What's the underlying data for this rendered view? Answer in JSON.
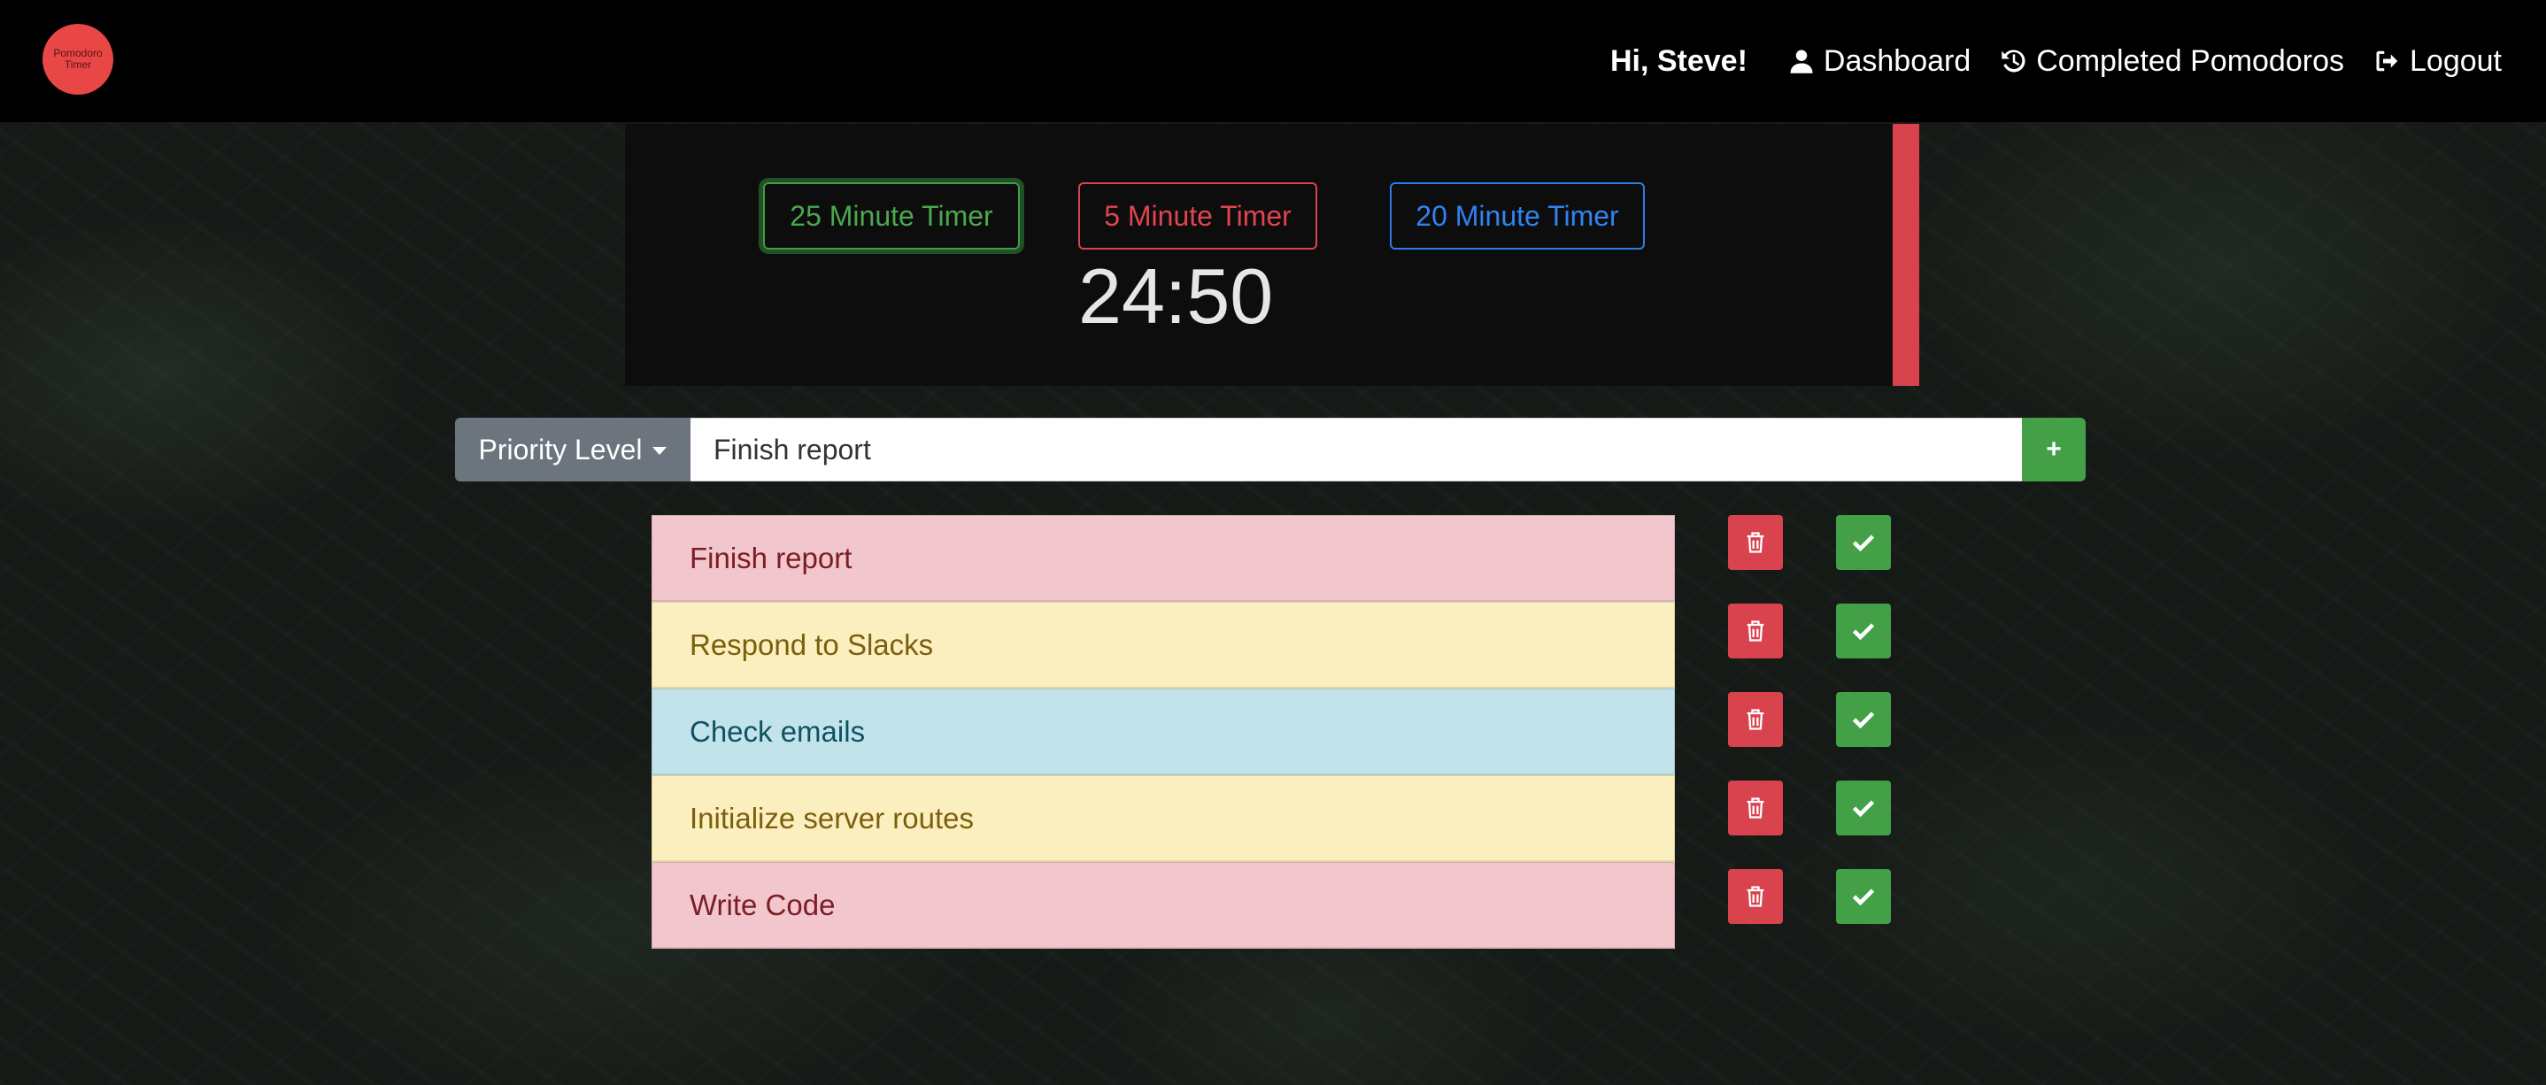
{
  "navbar": {
    "logo_line1": "Pomodoro",
    "logo_line2": "Timer",
    "greeting": "Hi, Steve!",
    "links": [
      {
        "label": "Dashboard",
        "icon": "user-icon"
      },
      {
        "label": "Completed Pomodoros",
        "icon": "history-icon"
      },
      {
        "label": "Logout",
        "icon": "sign-out-icon"
      }
    ]
  },
  "timer": {
    "buttons": [
      {
        "label": "25 Minute Timer",
        "color": "#3c9f43"
      },
      {
        "label": "5 Minute Timer",
        "color": "#d9434e"
      },
      {
        "label": "20 Minute Timer",
        "color": "#2f7ce8"
      }
    ],
    "time": "24:50"
  },
  "task_input": {
    "priority_label": "Priority Level",
    "value": "Finish report",
    "add_label": "+"
  },
  "tasks": [
    {
      "text": "Finish report",
      "priority": "danger",
      "color": "#f1c6cc"
    },
    {
      "text": "Respond to Slacks",
      "priority": "warning",
      "color": "#fcefbf"
    },
    {
      "text": "Check emails",
      "priority": "info",
      "color": "#c3e3ea"
    },
    {
      "text": "Initialize server routes",
      "priority": "warning",
      "color": "#fcefbf"
    },
    {
      "text": "Write Code",
      "priority": "danger",
      "color": "#f1c6cc"
    }
  ],
  "colors": {
    "danger": "#d9434e",
    "success": "#43a047",
    "secondary": "#6c757d"
  }
}
